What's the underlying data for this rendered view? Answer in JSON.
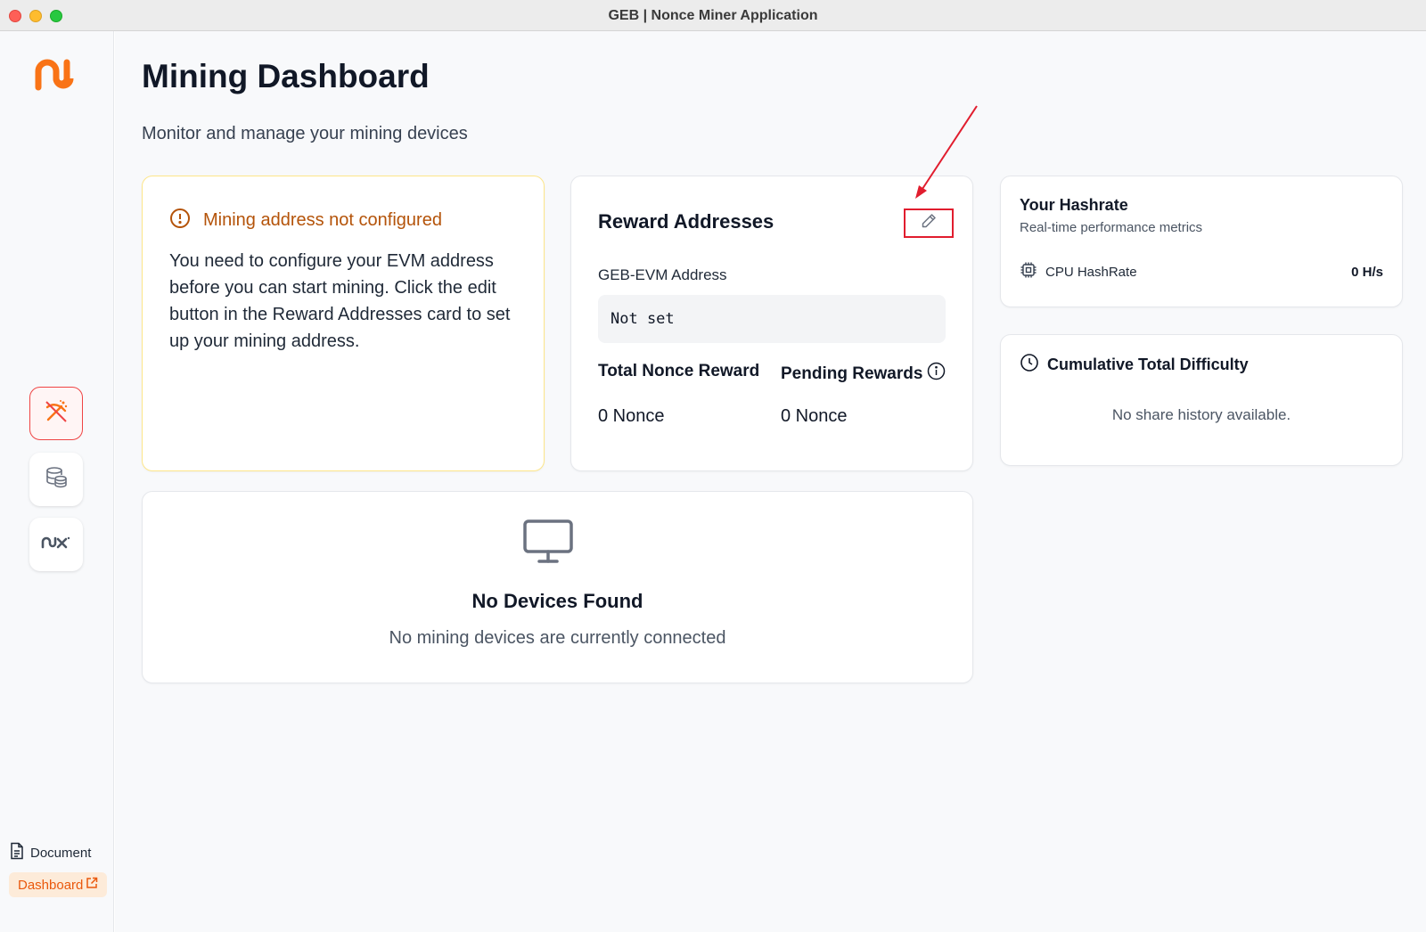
{
  "window": {
    "title": "GEB | Nonce Miner Application"
  },
  "sidebar": {
    "nav": [
      {
        "icon": "pickaxe-icon",
        "active": true
      },
      {
        "icon": "database-icon",
        "active": false
      },
      {
        "icon": "nx-logo-icon",
        "active": false
      }
    ],
    "document_label": "Document",
    "dashboard_label": "Dashboard",
    "accent": "#f97316"
  },
  "page": {
    "title": "Mining Dashboard",
    "subtitle": "Monitor and manage your mining devices"
  },
  "warning": {
    "title": "Mining address not configured",
    "body": "You need to configure your EVM address before you can start mining. Click the edit button in the Reward Addresses card to set up your mining address.",
    "color": "#b45309"
  },
  "rewards": {
    "title": "Reward Addresses",
    "evm_label": "GEB-EVM Address",
    "evm_value": "Not set",
    "total_label": "Total Nonce Reward",
    "total_value": "0 Nonce",
    "pending_label": "Pending Rewards",
    "pending_value": "0 Nonce"
  },
  "hashrate": {
    "title": "Your Hashrate",
    "subtitle": "Real-time performance metrics",
    "cpu_label": "CPU HashRate",
    "cpu_value": "0 H/s"
  },
  "difficulty": {
    "title": "Cumulative Total Difficulty",
    "empty": "No share history available."
  },
  "devices": {
    "title": "No Devices Found",
    "subtitle": "No mining devices are currently connected"
  },
  "annotation": {
    "color": "#e11d2e"
  }
}
